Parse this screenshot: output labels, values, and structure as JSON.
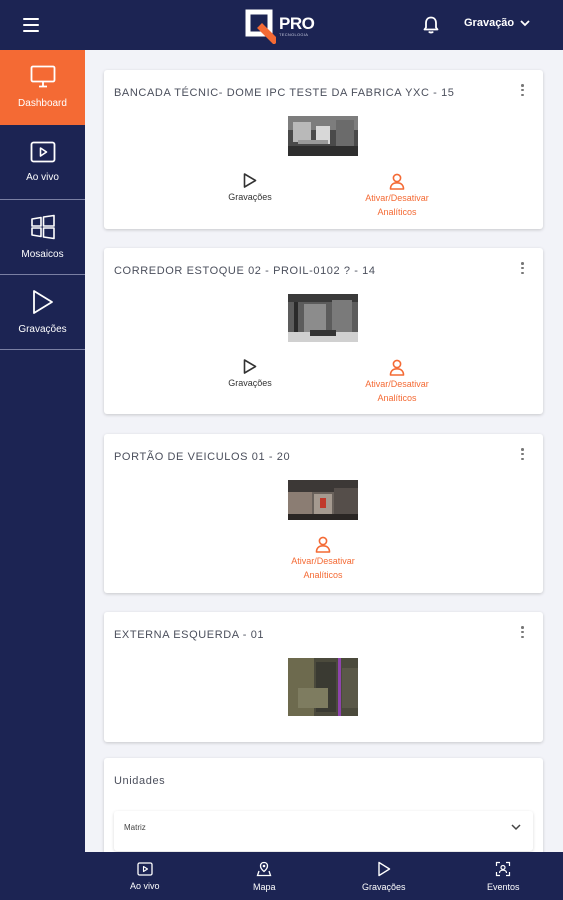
{
  "header": {
    "logo_text": "PRO",
    "logo_sub": "TECNOLOGIA",
    "user_menu_label": "Gravação"
  },
  "sidebar": {
    "items": [
      {
        "label": "Dashboard",
        "icon": "monitor-icon",
        "active": true
      },
      {
        "label": "Ao vivo",
        "icon": "play-screen-icon"
      },
      {
        "label": "Mosaicos",
        "icon": "windows-icon"
      },
      {
        "label": "Gravações",
        "icon": "play-icon"
      }
    ]
  },
  "cameras": [
    {
      "title": "BANCADA TÉCNIC- DOME IPC TESTE DA FABRICA YXC - 15",
      "play_label": "Gravações",
      "analytics_label_1": "Ativar/Desativar",
      "analytics_label_2": "Analíticos"
    },
    {
      "title": "CORREDOR ESTOQUE 02 - PROIL-0102 ? - 14",
      "play_label": "Gravações",
      "analytics_label_1": "Ativar/Desativar",
      "analytics_label_2": "Analíticos"
    },
    {
      "title": "PORTÃO DE VEICULOS 01 - 20",
      "analytics_label_1": "Ativar/Desativar",
      "analytics_label_2": "Analíticos"
    },
    {
      "title": "EXTERNA ESQUERDA - 01"
    }
  ],
  "units": {
    "title": "Unidades",
    "selected": "Matriz"
  },
  "bottom_nav": {
    "items": [
      {
        "label": "Ao vivo",
        "icon": "play-screen-icon"
      },
      {
        "label": "Mapa",
        "icon": "map-icon"
      },
      {
        "label": "Gravações",
        "icon": "play-icon"
      },
      {
        "label": "Eventos",
        "icon": "face-scan-icon"
      }
    ]
  },
  "colors": {
    "navy": "#1c2453",
    "accent": "#f46a34",
    "background": "#f2f3f8"
  }
}
